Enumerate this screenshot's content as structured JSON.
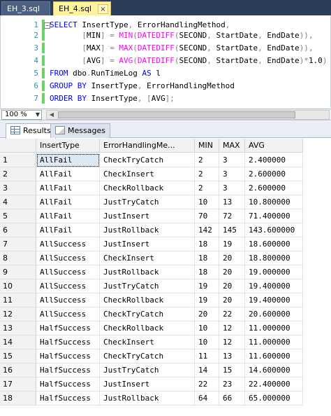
{
  "tabs": [
    {
      "label": "EH_3.sql",
      "active": false
    },
    {
      "label": "EH_4.sql",
      "active": true,
      "close_glyph": "×"
    }
  ],
  "editor": {
    "lines": [
      {
        "n": "1",
        "changed": true,
        "collapse": "−",
        "tokens": [
          [
            "kw",
            "SELECT"
          ],
          [
            "tx",
            " InsertType"
          ],
          [
            "gr",
            ","
          ],
          [
            "tx",
            " ErrorHandlingMethod"
          ],
          [
            "gr",
            ","
          ]
        ]
      },
      {
        "n": "2",
        "changed": true,
        "tokens": [
          [
            "tx",
            "       "
          ],
          [
            "gr",
            "["
          ],
          [
            "tx",
            "MIN"
          ],
          [
            "gr",
            "]"
          ],
          [
            "tx",
            " "
          ],
          [
            "gr",
            "="
          ],
          [
            "tx",
            " "
          ],
          [
            "fn",
            "MIN"
          ],
          [
            "gr",
            "("
          ],
          [
            "fn",
            "DATEDIFF"
          ],
          [
            "gr",
            "("
          ],
          [
            "tx",
            "SECOND"
          ],
          [
            "gr",
            ","
          ],
          [
            "tx",
            " StartDate"
          ],
          [
            "gr",
            ","
          ],
          [
            "tx",
            " EndDate"
          ],
          [
            "gr",
            "))"
          ],
          [
            "gr",
            ","
          ]
        ]
      },
      {
        "n": "3",
        "changed": true,
        "tokens": [
          [
            "tx",
            "       "
          ],
          [
            "gr",
            "["
          ],
          [
            "tx",
            "MAX"
          ],
          [
            "gr",
            "]"
          ],
          [
            "tx",
            " "
          ],
          [
            "gr",
            "="
          ],
          [
            "tx",
            " "
          ],
          [
            "fn",
            "MAX"
          ],
          [
            "gr",
            "("
          ],
          [
            "fn",
            "DATEDIFF"
          ],
          [
            "gr",
            "("
          ],
          [
            "tx",
            "SECOND"
          ],
          [
            "gr",
            ","
          ],
          [
            "tx",
            " StartDate"
          ],
          [
            "gr",
            ","
          ],
          [
            "tx",
            " EndDate"
          ],
          [
            "gr",
            "))"
          ],
          [
            "gr",
            ","
          ]
        ]
      },
      {
        "n": "4",
        "changed": true,
        "tokens": [
          [
            "tx",
            "       "
          ],
          [
            "gr",
            "["
          ],
          [
            "tx",
            "AVG"
          ],
          [
            "gr",
            "]"
          ],
          [
            "tx",
            " "
          ],
          [
            "gr",
            "="
          ],
          [
            "tx",
            " "
          ],
          [
            "fn",
            "AVG"
          ],
          [
            "gr",
            "("
          ],
          [
            "fn",
            "DATEDIFF"
          ],
          [
            "gr",
            "("
          ],
          [
            "tx",
            "SECOND"
          ],
          [
            "gr",
            ","
          ],
          [
            "tx",
            " StartDate"
          ],
          [
            "gr",
            ","
          ],
          [
            "tx",
            " EndDate"
          ],
          [
            "gr",
            ")*"
          ],
          [
            "tx",
            "1.0"
          ],
          [
            "gr",
            ")"
          ]
        ]
      },
      {
        "n": "5",
        "changed": true,
        "tokens": [
          [
            "kw",
            "FROM"
          ],
          [
            "tx",
            " dbo"
          ],
          [
            "gr",
            "."
          ],
          [
            "tx",
            "RunTimeLog "
          ],
          [
            "kw",
            "AS"
          ],
          [
            "tx",
            " l"
          ]
        ]
      },
      {
        "n": "6",
        "changed": true,
        "tokens": [
          [
            "kw",
            "GROUP BY"
          ],
          [
            "tx",
            " InsertType"
          ],
          [
            "gr",
            ","
          ],
          [
            "tx",
            " ErrorHandlingMethod"
          ]
        ]
      },
      {
        "n": "7",
        "changed": true,
        "tokens": [
          [
            "kw",
            "ORDER BY"
          ],
          [
            "tx",
            " InsertType"
          ],
          [
            "gr",
            ","
          ],
          [
            "tx",
            " "
          ],
          [
            "gr",
            "["
          ],
          [
            "tx",
            "AVG"
          ],
          [
            "gr",
            "];"
          ]
        ]
      }
    ]
  },
  "zoom": {
    "value": "100 %",
    "arrow": "▼"
  },
  "scroll": {
    "left_arrow": "◀"
  },
  "results_tabs": [
    {
      "label": "Results",
      "icon": "grid-icon",
      "active": true
    },
    {
      "label": "Messages",
      "icon": "messages-icon",
      "active": false
    }
  ],
  "grid": {
    "columns": [
      "InsertType",
      "ErrorHandlingMe...",
      "MIN",
      "MAX",
      "AVG"
    ],
    "rows": [
      [
        "1",
        "AllFail",
        "CheckTryCatch",
        "2",
        "3",
        "2.400000"
      ],
      [
        "2",
        "AllFail",
        "CheckInsert",
        "2",
        "3",
        "2.600000"
      ],
      [
        "3",
        "AllFail",
        "CheckRollback",
        "2",
        "3",
        "2.600000"
      ],
      [
        "4",
        "AllFail",
        "JustTryCatch",
        "10",
        "13",
        "10.800000"
      ],
      [
        "5",
        "AllFail",
        "JustInsert",
        "70",
        "72",
        "71.400000"
      ],
      [
        "6",
        "AllFail",
        "JustRollback",
        "142",
        "145",
        "143.600000"
      ],
      [
        "7",
        "AllSuccess",
        "JustInsert",
        "18",
        "19",
        "18.600000"
      ],
      [
        "8",
        "AllSuccess",
        "CheckInsert",
        "18",
        "20",
        "18.800000"
      ],
      [
        "9",
        "AllSuccess",
        "JustRollback",
        "18",
        "20",
        "19.000000"
      ],
      [
        "10",
        "AllSuccess",
        "JustTryCatch",
        "19",
        "20",
        "19.400000"
      ],
      [
        "11",
        "AllSuccess",
        "CheckRollback",
        "19",
        "20",
        "19.400000"
      ],
      [
        "12",
        "AllSuccess",
        "CheckTryCatch",
        "20",
        "22",
        "20.600000"
      ],
      [
        "13",
        "HalfSuccess",
        "CheckRollback",
        "10",
        "12",
        "11.000000"
      ],
      [
        "14",
        "HalfSuccess",
        "CheckInsert",
        "10",
        "12",
        "11.000000"
      ],
      [
        "15",
        "HalfSuccess",
        "CheckTryCatch",
        "11",
        "13",
        "11.600000"
      ],
      [
        "16",
        "HalfSuccess",
        "JustTryCatch",
        "14",
        "15",
        "14.600000"
      ],
      [
        "17",
        "HalfSuccess",
        "JustInsert",
        "22",
        "23",
        "22.400000"
      ],
      [
        "18",
        "HalfSuccess",
        "JustRollback",
        "64",
        "66",
        "65.000000"
      ]
    ],
    "selected": {
      "row": 0,
      "col": 1
    }
  }
}
